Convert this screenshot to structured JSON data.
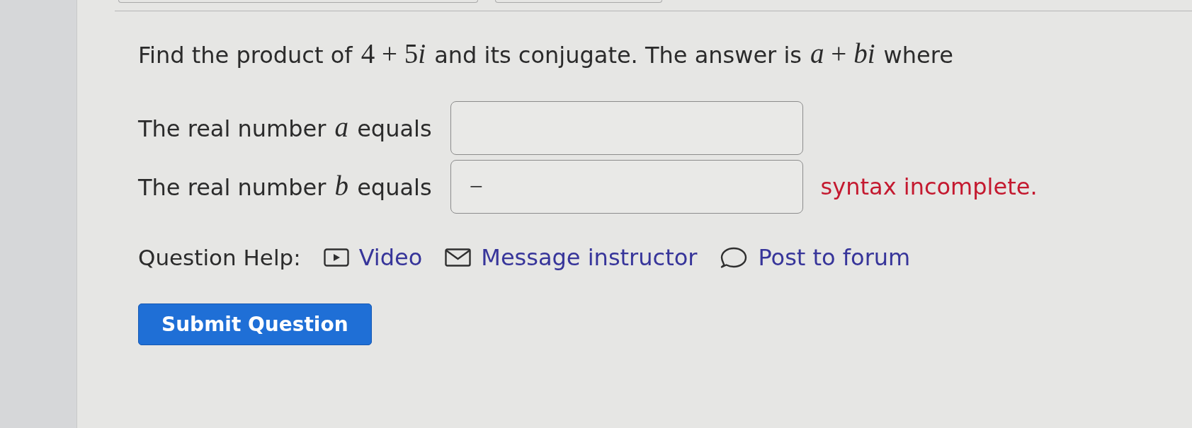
{
  "question": {
    "segments": [
      {
        "kind": "text",
        "text": "Find the product of "
      },
      {
        "kind": "math",
        "text": "4 + 5i"
      },
      {
        "kind": "text",
        "text": " and its conjugate. The answer is "
      },
      {
        "kind": "math",
        "text": "a + bi"
      },
      {
        "kind": "text",
        "text": " where"
      }
    ]
  },
  "answers": [
    {
      "label": [
        {
          "kind": "text",
          "text": "The real number "
        },
        {
          "kind": "math",
          "text": "a"
        },
        {
          "kind": "text",
          "text": " equals"
        }
      ]
    },
    {
      "label": [
        {
          "kind": "text",
          "text": "The real number "
        },
        {
          "kind": "math",
          "text": "b"
        },
        {
          "kind": "text",
          "text": " equals"
        }
      ],
      "value": "−",
      "feedback": "syntax incomplete."
    }
  ],
  "help": {
    "label": "Question Help:",
    "links": [
      {
        "kind": "video",
        "text": "Video"
      },
      {
        "kind": "message",
        "text": "Message instructor"
      },
      {
        "kind": "forum",
        "text": "Post to forum"
      }
    ]
  },
  "submit": {
    "label": "Submit Question"
  }
}
